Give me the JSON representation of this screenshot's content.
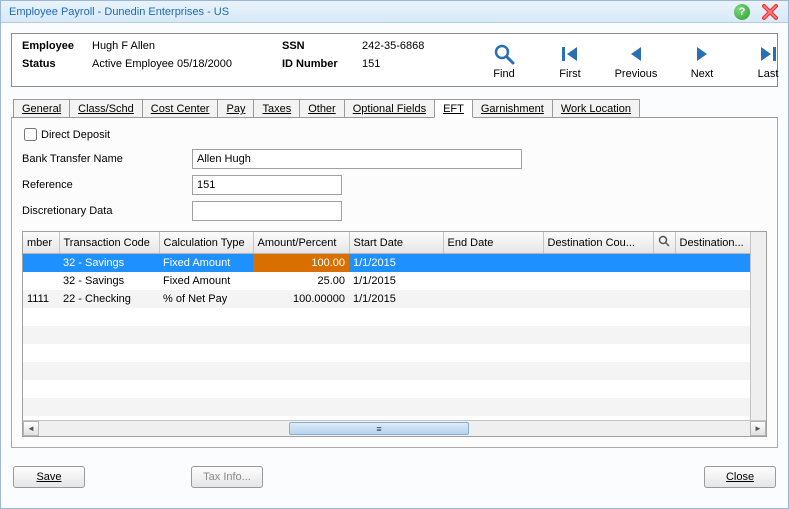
{
  "title": "Employee Payroll - Dunedin Enterprises - US",
  "info": {
    "employee_lbl": "Employee",
    "employee_val": "Hugh F Allen",
    "status_lbl": "Status",
    "status_val": "Active Employee 05/18/2000",
    "ssn_lbl": "SSN",
    "ssn_val": "242-35-6868",
    "id_lbl": "ID Number",
    "id_val": "151"
  },
  "nav": {
    "find": "Find",
    "first": "First",
    "previous": "Previous",
    "next": "Next",
    "last": "Last"
  },
  "tabs": {
    "general": "General",
    "class_schd": "Class/Schd",
    "cost_center": "Cost Center",
    "pay": "Pay",
    "taxes": "Taxes",
    "other": "Other",
    "optional": "Optional Fields",
    "eft": "EFT",
    "garnishment": "Garnishment",
    "work_location": "Work Location"
  },
  "eft": {
    "direct_deposit_lbl": "Direct Deposit",
    "bank_transfer_lbl": "Bank Transfer Name",
    "bank_transfer_val": "Allen Hugh",
    "reference_lbl": "Reference",
    "reference_val": "151",
    "discretionary_lbl": "Discretionary Data",
    "discretionary_val": ""
  },
  "grid": {
    "headers": {
      "number": "mber",
      "txn_code": "Transaction Code",
      "calc_type": "Calculation Type",
      "amount": "Amount/Percent",
      "start_date": "Start Date",
      "end_date": "End Date",
      "dest_country": "Destination Cou...",
      "dest": "Destination..."
    },
    "rows": [
      {
        "number": "",
        "txn_code": "32 - Savings",
        "calc_type": "Fixed Amount",
        "amount": "100.00",
        "start_date": "1/1/2015",
        "end_date": "",
        "dest_country": "",
        "selected": true
      },
      {
        "number": "",
        "txn_code": "32 - Savings",
        "calc_type": "Fixed Amount",
        "amount": "25.00",
        "start_date": "1/1/2015",
        "end_date": "",
        "dest_country": "",
        "selected": false
      },
      {
        "number": "1111",
        "txn_code": "22 - Checking",
        "calc_type": "% of Net Pay",
        "amount": "100.00000",
        "start_date": "1/1/2015",
        "end_date": "",
        "dest_country": "",
        "selected": false
      }
    ]
  },
  "buttons": {
    "save": "Save",
    "tax_info": "Tax Info...",
    "close": "Close"
  },
  "icons": {
    "help": "?",
    "magnifier": "🔍"
  }
}
